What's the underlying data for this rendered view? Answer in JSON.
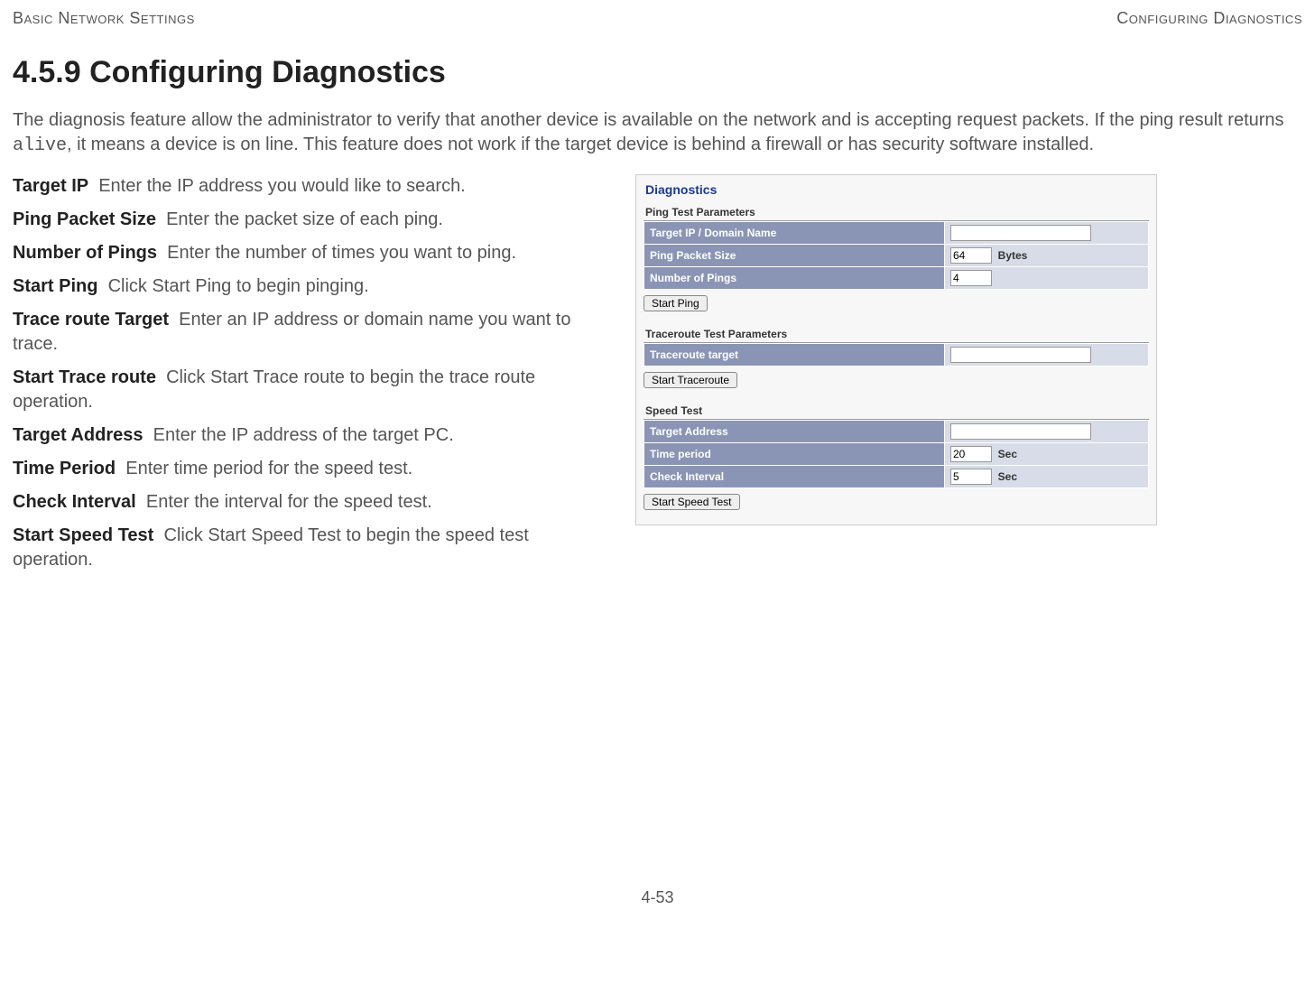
{
  "header": {
    "left": "Basic Network Settings",
    "right": "Configuring Diagnostics"
  },
  "section_title": "4.5.9 Configuring Diagnostics",
  "intro_pre": "The diagnosis feature allow the administrator to verify that another device is available on the network and is accepting request packets. If the ping result returns ",
  "intro_code": "alive",
  "intro_post": ", it means a device is on line. This feature does not work if the target device is behind a firewall or has security software installed.",
  "defs": [
    {
      "term": "Target IP",
      "desc": "Enter the IP address you would like to search."
    },
    {
      "term": "Ping Packet Size",
      "desc": "Enter the packet size of each ping."
    },
    {
      "term": "Number of Pings",
      "desc": "Enter the number of times you want to ping."
    },
    {
      "term": "Start Ping",
      "desc": "Click Start Ping to begin pinging."
    },
    {
      "term": "Trace route Target",
      "desc": "Enter an IP address or domain name you want to trace."
    },
    {
      "term": "Start Trace route",
      "desc": "Click Start Trace route to begin the trace route operation."
    },
    {
      "term": "Target Address",
      "desc": "Enter the IP address of the target PC."
    },
    {
      "term": "Time Period",
      "desc": "Enter time period for the speed test."
    },
    {
      "term": "Check Interval",
      "desc": "Enter the interval for the speed test."
    },
    {
      "term": "Start Speed Test",
      "desc": "Click Start Speed Test to begin the speed test operation."
    }
  ],
  "panel": {
    "title": "Diagnostics",
    "ping": {
      "group": "Ping Test Parameters",
      "target_label": "Target IP / Domain Name",
      "target_value": "",
      "size_label": "Ping Packet Size",
      "size_value": "64",
      "size_unit": "Bytes",
      "count_label": "Number of Pings",
      "count_value": "4",
      "button": "Start Ping"
    },
    "trace": {
      "group": "Traceroute Test Parameters",
      "target_label": "Traceroute target",
      "target_value": "",
      "button": "Start Traceroute"
    },
    "speed": {
      "group": "Speed Test",
      "addr_label": "Target Address",
      "addr_value": "",
      "period_label": "Time period",
      "period_value": "20",
      "period_unit": "Sec",
      "interval_label": "Check Interval",
      "interval_value": "5",
      "interval_unit": "Sec",
      "button": "Start Speed Test"
    }
  },
  "footer": "4-53"
}
